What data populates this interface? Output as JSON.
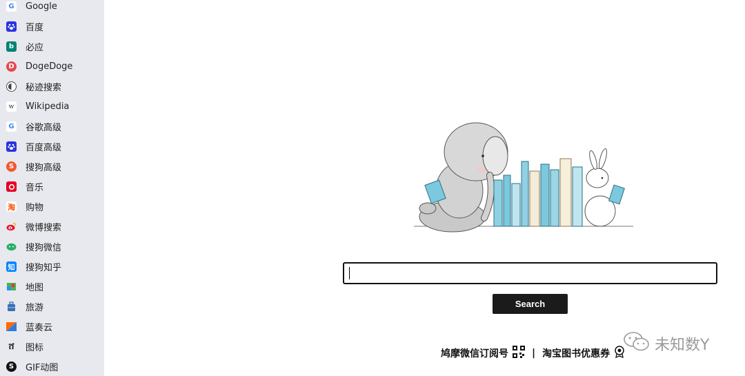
{
  "sidebar": {
    "items": [
      {
        "label": "Google",
        "icon": "google-icon",
        "color": "#4285f4"
      },
      {
        "label": "百度",
        "icon": "baidu-paw-icon",
        "color": "#2932e1"
      },
      {
        "label": "必应",
        "icon": "bing-icon",
        "color": "#008373"
      },
      {
        "label": "DogeDoge",
        "icon": "dogedoge-icon",
        "color": "#e5484d"
      },
      {
        "label": "秘迹搜索",
        "icon": "mijisou-icon",
        "color": "#555555"
      },
      {
        "label": "Wikipedia",
        "icon": "wikipedia-icon",
        "color": "#ffffff"
      },
      {
        "label": "谷歌高级",
        "icon": "google-advanced-icon",
        "color": "#4285f4"
      },
      {
        "label": "百度高级",
        "icon": "baidu-advanced-icon",
        "color": "#2932e1"
      },
      {
        "label": "搜狗高级",
        "icon": "sogou-icon",
        "color": "#f2572d"
      },
      {
        "label": "音乐",
        "icon": "netease-music-icon",
        "color": "#e60026"
      },
      {
        "label": "购物",
        "icon": "taobao-icon",
        "color": "#ff5000"
      },
      {
        "label": "微博搜索",
        "icon": "weibo-icon",
        "color": "#e6162d"
      },
      {
        "label": "搜狗微信",
        "icon": "wechat-icon",
        "color": "#2aae67"
      },
      {
        "label": "搜狗知乎",
        "icon": "zhihu-icon",
        "color": "#0084ff"
      },
      {
        "label": "地图",
        "icon": "map-icon",
        "color": "#34a853"
      },
      {
        "label": "旅游",
        "icon": "travel-icon",
        "color": "#3d6fb6"
      },
      {
        "label": "蓝奏云",
        "icon": "lanzou-icon",
        "color": "#ff6a00"
      },
      {
        "label": "图标",
        "icon": "iconfont-icon",
        "color": "#222222"
      },
      {
        "label": "GIF动图",
        "icon": "gif-icon",
        "color": "#111111"
      }
    ]
  },
  "search": {
    "placeholder": "",
    "value": "",
    "button_label": "Search"
  },
  "footer": {
    "link1": "鸠摩微信订阅号",
    "separator": "|",
    "link2": "淘宝图书优惠券"
  },
  "watermark": {
    "text": "未知数Y"
  },
  "colors": {
    "sidebar_bg": "#e8e9ee",
    "button_bg": "#1b1b1b",
    "book_blue": "#7cc8de"
  }
}
